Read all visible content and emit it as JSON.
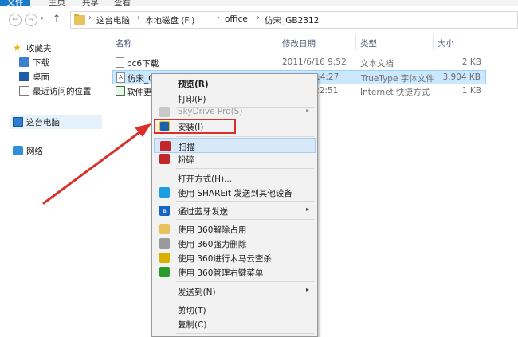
{
  "ribbon": {
    "tabs": [
      "文件",
      "主页",
      "共享",
      "查看"
    ]
  },
  "address": {
    "crumbs": [
      "这台电脑",
      "本地磁盘 (F:)",
      "office",
      "仿宋_GB2312"
    ],
    "sep": "›"
  },
  "nav": {
    "back": "←",
    "forward": "→",
    "dropdown": "▾",
    "up": "↑"
  },
  "sidebar": {
    "items": [
      {
        "label": "收藏夹"
      },
      {
        "label": "下载"
      },
      {
        "label": "桌面"
      },
      {
        "label": "最近访问的位置"
      },
      {
        "label": "这台电脑"
      },
      {
        "label": "网络"
      }
    ]
  },
  "columns": {
    "name": "名称",
    "date": "修改日期",
    "type": "类型",
    "size": "大小"
  },
  "files": [
    {
      "name": "pc6下载",
      "date": "2011/6/16 9:52",
      "type": "文本文档",
      "size": "2 KB"
    },
    {
      "name": "仿宋_GB",
      "date": "9 14:27",
      "type": "TrueType 字体文件",
      "size": "3,904 KB",
      "icon_glyph": "A"
    },
    {
      "name": "软件更新",
      "date": "3 22:51",
      "type": "Internet 快捷方式",
      "size": "1 KB"
    }
  ],
  "menu": {
    "preview": "预览(R)",
    "print": "打印(P)",
    "skydrive": "SkyDrive Pro(S)",
    "install": "安装(I)",
    "scan": "扫描",
    "shred": "粉碎",
    "openwith": "打开方式(H)...",
    "shareit": "使用 SHAREit 发送到其他设备",
    "bluetooth": "通过蓝牙发送",
    "unlock": "使用 360解除占用",
    "forcedel": "使用 360强力删除",
    "trojan": "使用 360进行木马云查杀",
    "rightmenu": "使用 360管理右键菜单",
    "sendto": "发送到(N)",
    "cut": "剪切(T)",
    "copy": "复制(C)",
    "submenu_arrow": "▸",
    "bt_glyph": "ʙ"
  },
  "colors": {
    "annotation": "#d9302c",
    "selection": "#cce8ff",
    "accent": "#1979ca"
  }
}
